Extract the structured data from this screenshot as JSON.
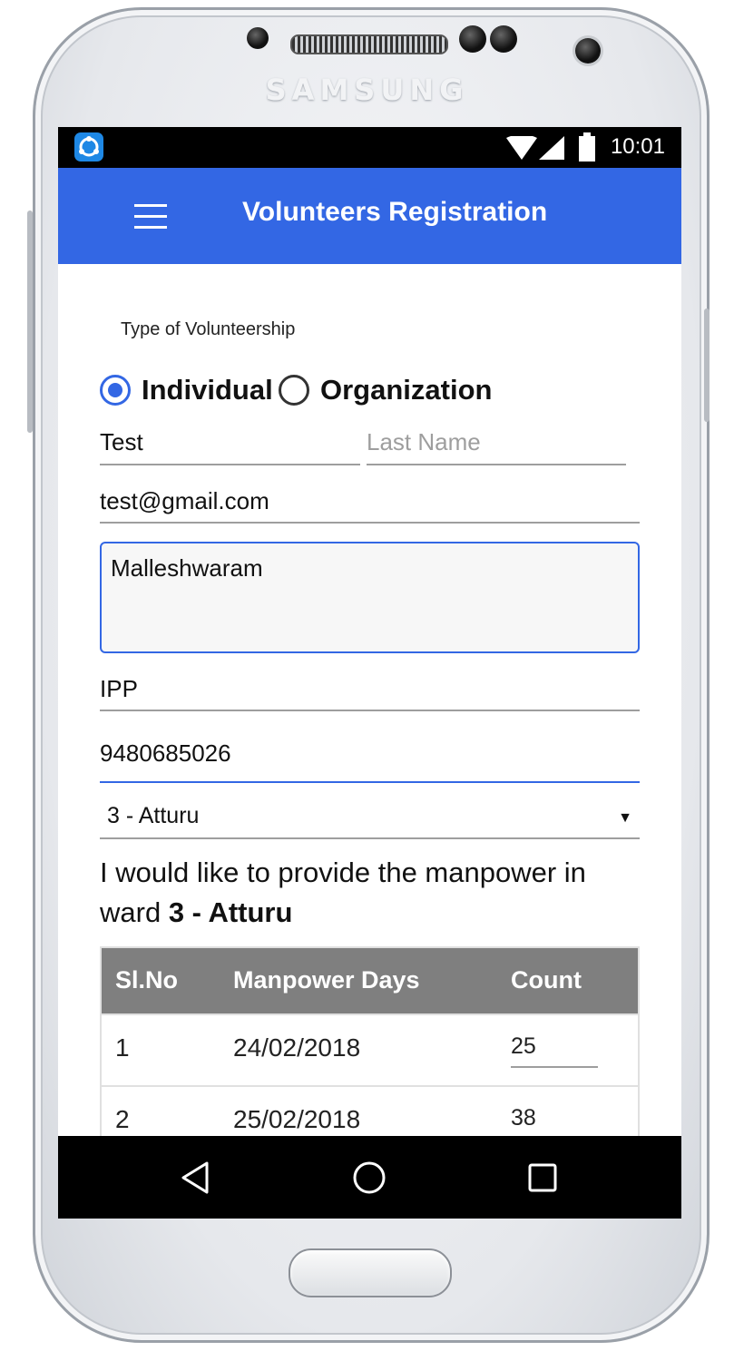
{
  "device": {
    "brand": "SAMSUNG"
  },
  "status_bar": {
    "time": "10:01",
    "app_icon": "shareit-icon"
  },
  "app_bar": {
    "title": "Volunteers Registration",
    "menu_icon": "hamburger-menu-icon"
  },
  "form": {
    "volunteership_label": "Type of Volunteership",
    "options": [
      {
        "label": "Individual",
        "selected": true
      },
      {
        "label": "Organization",
        "selected": false
      }
    ],
    "first_name": {
      "value": "Test"
    },
    "last_name": {
      "value": "",
      "placeholder": "Last Name"
    },
    "email": {
      "value": "test@gmail.com"
    },
    "address": {
      "value": "Malleshwaram"
    },
    "organization": {
      "value": "IPP"
    },
    "phone": {
      "value": "9480685026"
    },
    "ward_select": {
      "value": "3 - Atturu"
    }
  },
  "manpower": {
    "prefix": "I would like to provide the manpower in ward ",
    "ward": "3 - Atturu",
    "table": {
      "headers": [
        "Sl.No",
        "Manpower Days",
        "Count"
      ],
      "rows": [
        {
          "sl": "1",
          "date": "24/02/2018",
          "count": "25"
        },
        {
          "sl": "2",
          "date": "25/02/2018",
          "count": "38"
        }
      ]
    }
  },
  "colors": {
    "primary": "#3367e4",
    "header_gray": "#7f7f7f",
    "status_bar": "#000000"
  }
}
